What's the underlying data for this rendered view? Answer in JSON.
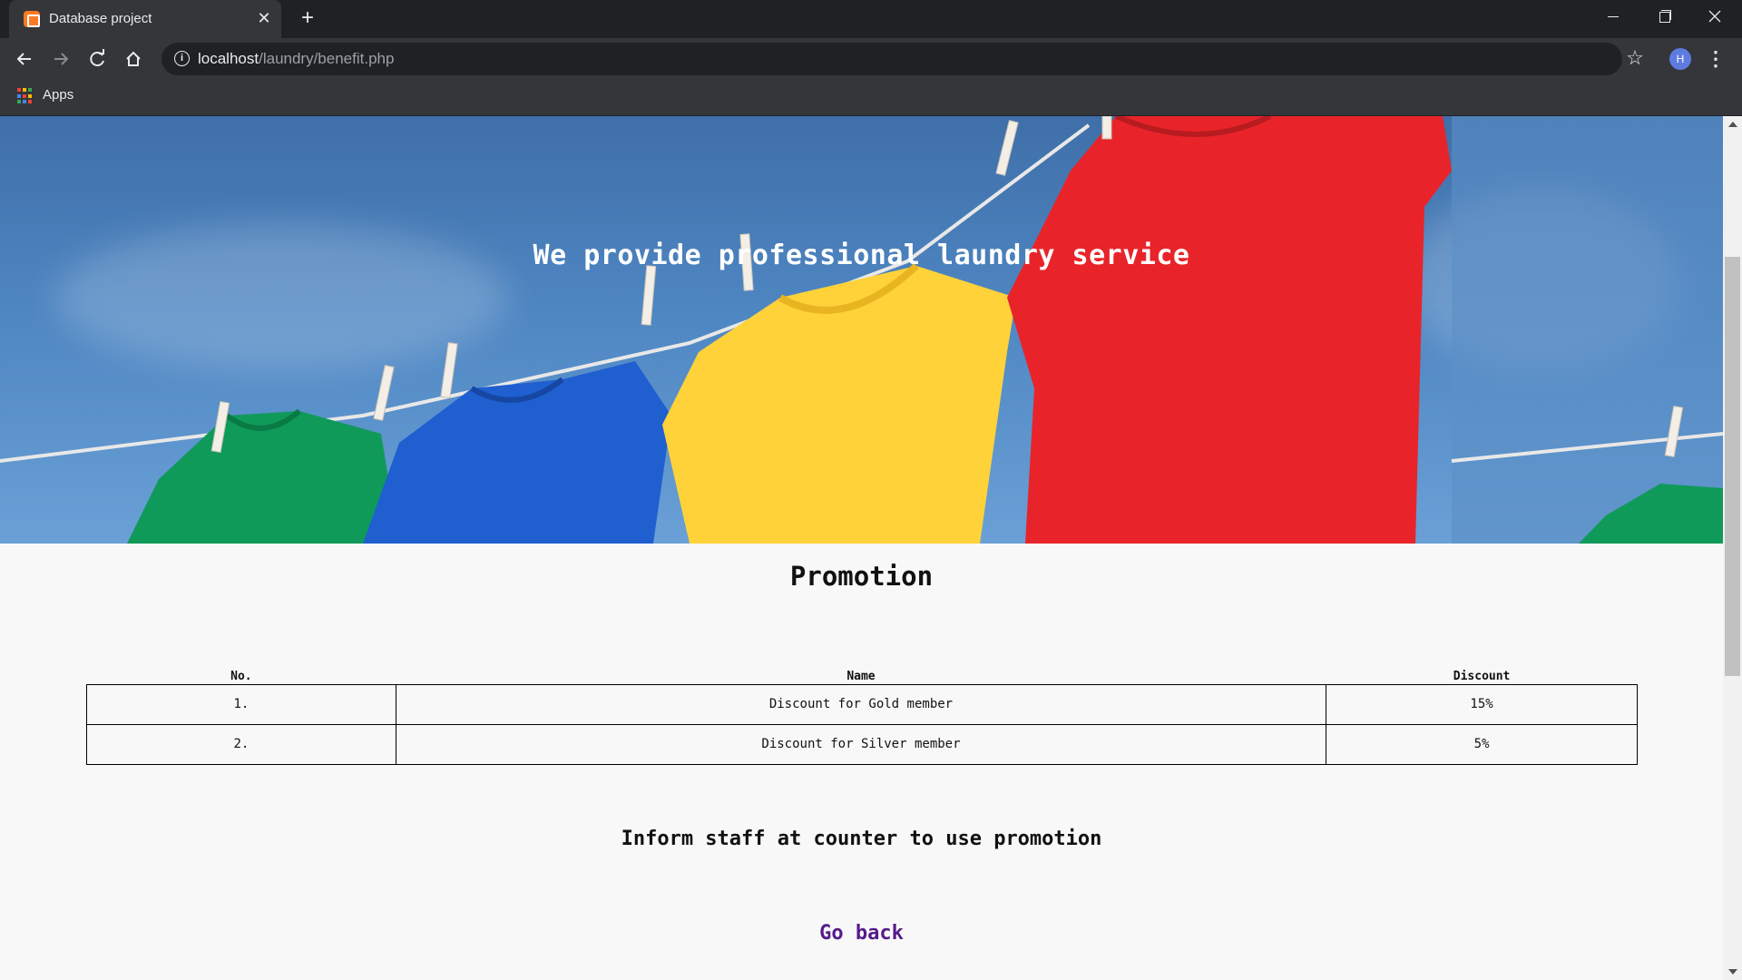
{
  "browser": {
    "tab_title": "Database project",
    "url_host": "localhost",
    "url_path": "/laundry/benefit.php",
    "avatar_initial": "H",
    "bookmarks": {
      "apps_label": "Apps"
    }
  },
  "page": {
    "hero_text": "We provide professional laundry service",
    "promotion_title": "Promotion",
    "table": {
      "headers": [
        "No.",
        "Name",
        "Discount"
      ],
      "rows": [
        [
          "1.",
          "Discount for Gold member",
          "15%"
        ],
        [
          "2.",
          "Discount for Silver member",
          "5%"
        ]
      ]
    },
    "inform_text": "Inform staff at counter to use promotion",
    "go_back_label": "Go back"
  },
  "colors": {
    "link_visited": "#551a8b",
    "sky": "#4e86c2",
    "shirt_green": "#0f9a5a",
    "shirt_blue": "#1f5fd0",
    "shirt_yellow": "#ffd23a",
    "shirt_red": "#e8242a"
  },
  "icons": [
    "favicon",
    "close-icon",
    "plus-icon",
    "back-arrow-icon",
    "forward-arrow-icon",
    "reload-icon",
    "home-icon",
    "info-icon",
    "star-icon",
    "menu-icon",
    "apps-grid-icon"
  ]
}
